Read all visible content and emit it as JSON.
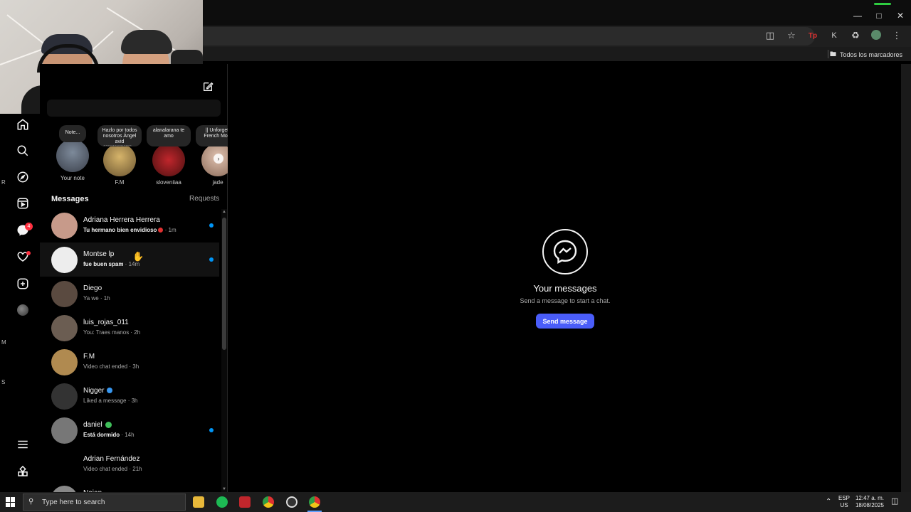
{
  "browser": {
    "bookmarks_folder": "Todos los marcadores",
    "window_controls": [
      "minimize-icon",
      "maximize-icon",
      "close-icon"
    ]
  },
  "notes": [
    {
      "bubble": "Note...",
      "name": "Your note"
    },
    {
      "bubble": "Hazlo por todos nosotros Ángel avid ⬚⬚⬚⬚⬚⬚...",
      "name": "F.M"
    },
    {
      "bubble": "alanalarana te amo",
      "name": "sloveniiaa"
    },
    {
      "bubble": "|| Unforgett French Mont",
      "name": "jade"
    }
  ],
  "panel": {
    "title": "Messages",
    "requests": "Requests"
  },
  "conversations": [
    {
      "name": "Adriana Herrera Herrera",
      "preview": "Tu hermano bien envidioso",
      "time": " · 1m",
      "unread": true,
      "bold": true,
      "color": "#c79a8a"
    },
    {
      "name": "Montse lp",
      "preview": "fue buen spam",
      "time": " · 14m",
      "unread": true,
      "bold": true,
      "color": "#ededed"
    },
    {
      "name": "Diego",
      "preview": "Ya we",
      "time": " · 1h",
      "unread": false,
      "bold": false,
      "color": "#5a4a40"
    },
    {
      "name": "luis_rojas_011",
      "preview": "You: Traes manos",
      "time": " · 2h",
      "unread": false,
      "bold": false,
      "color": "#6b5d52"
    },
    {
      "name": "F.M",
      "preview": "Video chat ended",
      "time": " · 3h",
      "unread": false,
      "bold": false,
      "color": "#b08a50"
    },
    {
      "name": "Nigger",
      "preview": "Liked a message",
      "time": " · 3h",
      "unread": false,
      "bold": false,
      "color": "#333333"
    },
    {
      "name": "daniel",
      "preview": "Está dormido",
      "time": " · 14h",
      "unread": true,
      "bold": true,
      "color": "#777777"
    },
    {
      "name": "Adrian Fernández",
      "preview": "Video chat ended",
      "time": " · 21h",
      "unread": false,
      "bold": false,
      "color": "#000000"
    },
    {
      "name": "Naian",
      "preview": "",
      "time": "",
      "unread": false,
      "bold": false,
      "color": "#888888"
    }
  ],
  "empty_state": {
    "title": "Your messages",
    "subtitle": "Send a message to start a chat.",
    "button": "Send message"
  },
  "taskbar": {
    "search_placeholder": "Type here to search",
    "lang_line1": "ESP",
    "lang_line2": "US",
    "time": "12:47 a. m.",
    "date": "18/08/2025",
    "apps": [
      "file-explorer-icon",
      "spotify-icon",
      "news-app-icon",
      "chrome-icon",
      "obs-icon",
      "chrome-active-icon"
    ]
  },
  "rail_badge": "4",
  "edge_letters": [
    "R",
    "M",
    "S"
  ],
  "colors": {
    "accent_button": "#4a5df9",
    "unread_dot": "#0095f6",
    "notification_red": "#ff3040"
  }
}
